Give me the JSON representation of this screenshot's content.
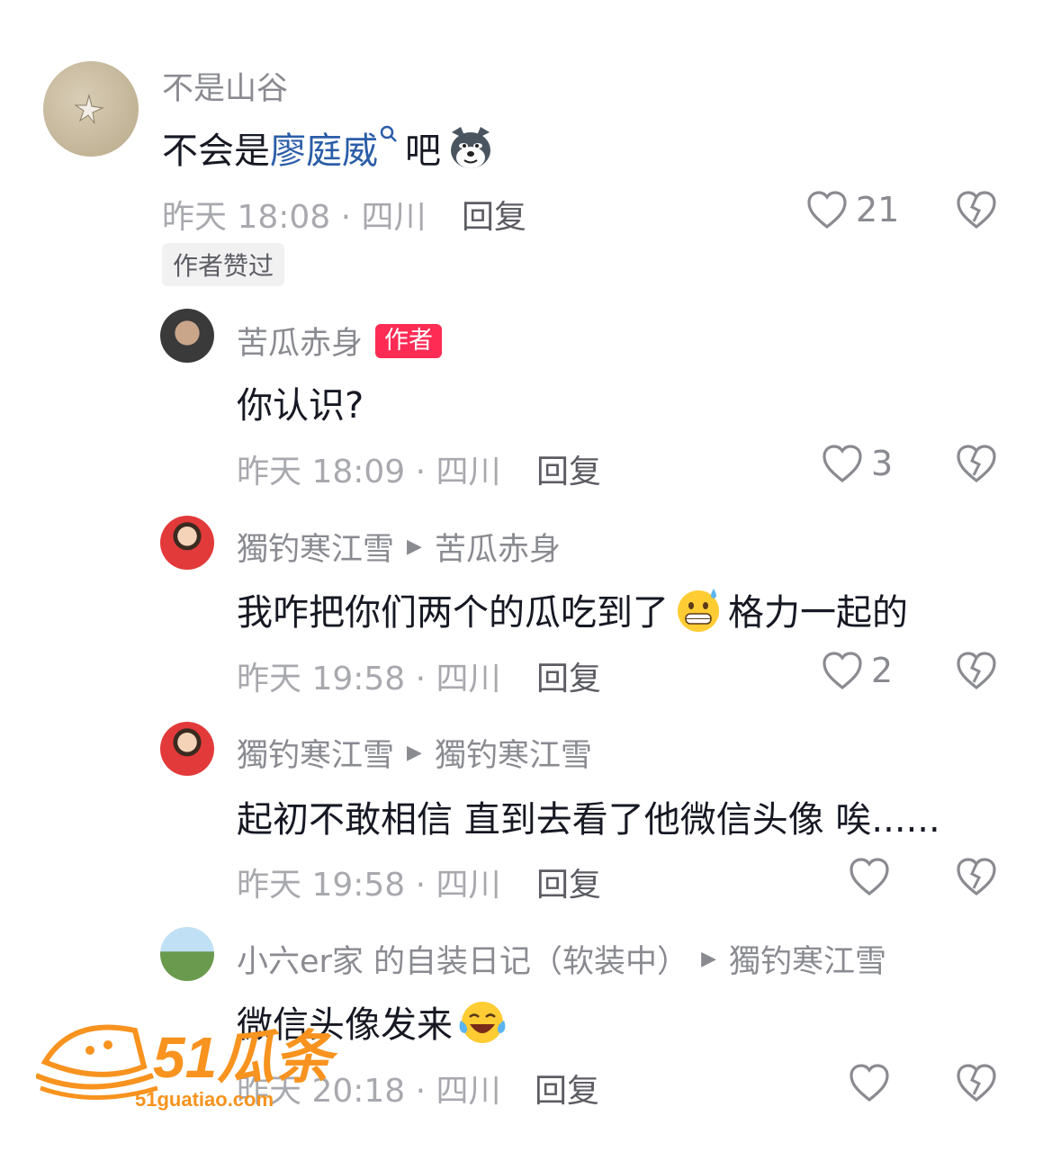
{
  "comments": [
    {
      "user": "不是山谷",
      "text_plain": "不会是",
      "link": "廖庭威",
      "text_after": "吧",
      "time": "昨天 18:08 · 四川",
      "reply": "回复",
      "likes": "21",
      "badge": "作者赞过"
    },
    {
      "user": "苦瓜赤身",
      "author_tag": "作者",
      "text": "你认识?",
      "time": "昨天 18:09 · 四川",
      "reply": "回复",
      "likes": "3"
    },
    {
      "user": "獨钓寒江雪",
      "reply_to": "苦瓜赤身",
      "text_before": "我咋把你们两个的瓜吃到了",
      "text_after": "格力一起的",
      "time": "昨天 19:58 · 四川",
      "reply": "回复",
      "likes": "2"
    },
    {
      "user": "獨钓寒江雪",
      "reply_to": "獨钓寒江雪",
      "text": "起初不敢相信 直到去看了他微信头像 唉......",
      "time": "昨天 19:58 · 四川",
      "reply": "回复",
      "likes": ""
    },
    {
      "user": "小六er家 的自装日记（软装中）",
      "reply_to": "獨钓寒江雪",
      "text": "微信头像发来",
      "time": "昨天 20:18 · 四川",
      "reply": "回复",
      "likes": ""
    }
  ],
  "watermark": {
    "brand": "51瓜条",
    "url": "51guatiao.com"
  },
  "colors": {
    "author_tag": "#fe2c55",
    "link": "#2b5da8",
    "watermark": "#f7931e"
  }
}
